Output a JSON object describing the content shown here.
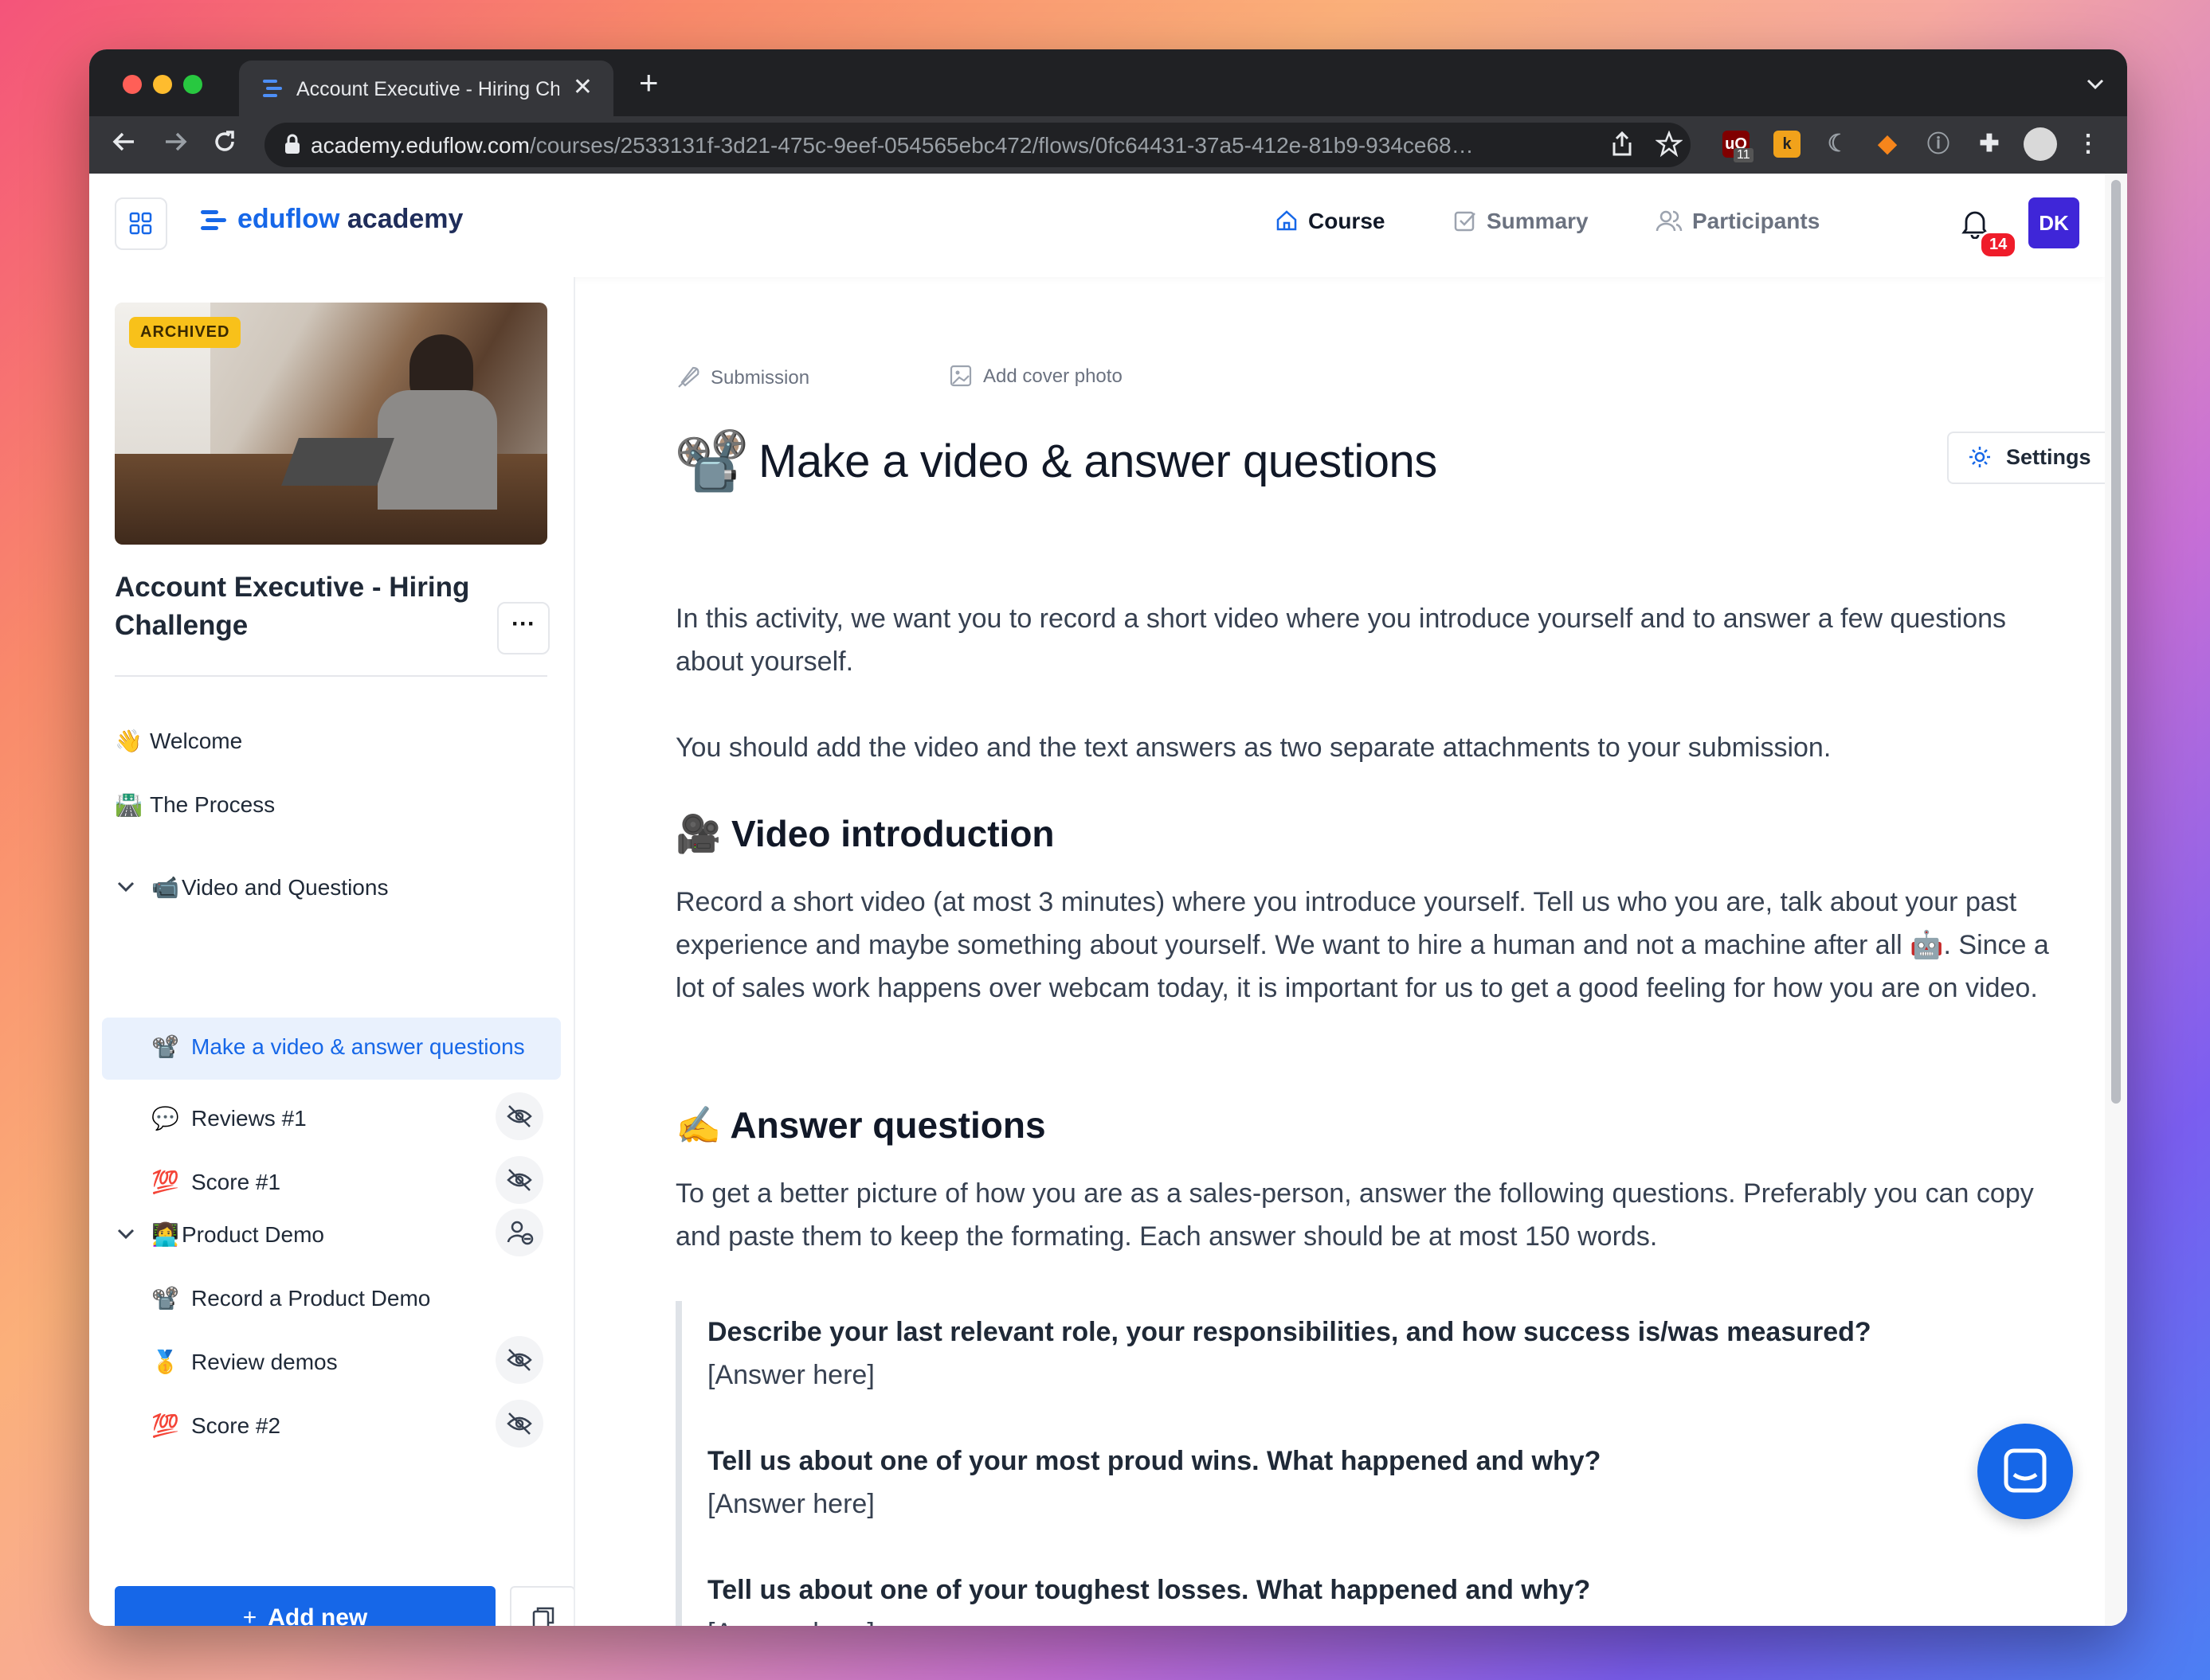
{
  "browser": {
    "tab_title": "Account Executive - Hiring Cha",
    "tab_close": "✕",
    "new_tab": "+",
    "url_host": "academy.eduflow.com",
    "url_path": "/courses/2533131f-3d21-475c-9eef-054565ebc472/flows/0fc64431-37a5-412e-81b9-934ce68…",
    "ext_badge": "11"
  },
  "header": {
    "logo_brand": "eduflow",
    "logo_suffix": " academy",
    "nav": [
      {
        "label": "Course"
      },
      {
        "label": "Summary"
      },
      {
        "label": "Participants"
      }
    ],
    "notification_count": "14",
    "avatar_initials": "DK"
  },
  "sidebar": {
    "badge": "ARCHIVED",
    "course_title": "Account Executive - Hiring Challenge",
    "more": "···",
    "items": [
      {
        "emoji": "👋",
        "label": "Welcome"
      },
      {
        "emoji": "🛣️",
        "label": "The Process"
      },
      {
        "emoji": "📹",
        "label": "Video and Questions"
      },
      {
        "emoji": "📽️",
        "label": "Make a video & answer questions"
      },
      {
        "emoji": "💬",
        "label": "Reviews #1"
      },
      {
        "emoji": "💯",
        "label": "Score #1"
      },
      {
        "emoji": "👩‍💻",
        "label": "Product Demo"
      },
      {
        "emoji": "📽️",
        "label": "Record a Product Demo"
      },
      {
        "emoji": "🥇",
        "label": "Review demos"
      },
      {
        "emoji": "💯",
        "label": "Score #2"
      }
    ],
    "add_new_label": "Add new",
    "add_new_plus": "+"
  },
  "main": {
    "meta_submission": "Submission",
    "meta_cover": "Add cover photo",
    "title_emoji": "📽️",
    "title": "Make a video & answer questions",
    "settings_label": "Settings",
    "intro_1": "In this activity, we want you to record a short video where you introduce yourself and to answer a few questions about yourself.",
    "intro_2": "You should add the video and the text answers as two separate attachments to your submission.",
    "h_video": "🎥 Video introduction",
    "video_text": "Record a short video (at most 3 minutes) where you introduce yourself. Tell us who you are, talk about your past experience and maybe something about yourself. We want to hire a human and not a machine after all 🤖. Since a lot of sales work happens over webcam today, it is important for us to get a good feeling for how you are on video.",
    "h_answer": "✍️ Answer questions",
    "answer_text": "To get a better picture of how you are as a sales-person, answer the following questions. Preferably you can copy and paste them to keep the formating. Each answer should be at most 150 words.",
    "questions": [
      {
        "q": "Describe your last relevant role, your responsibilities, and how success is/was measured?",
        "a": "[Answer here]"
      },
      {
        "q": "Tell us about one of your most proud wins. What happened and why?",
        "a": "[Answer here]"
      },
      {
        "q": "Tell us about one of your toughest losses. What happened and why?",
        "a": "[Answer here]"
      }
    ]
  },
  "colors": {
    "accent": "#1667e8",
    "badge": "#f8c11a",
    "notification": "#ef1c2a",
    "avatar": "#3f26d8"
  }
}
